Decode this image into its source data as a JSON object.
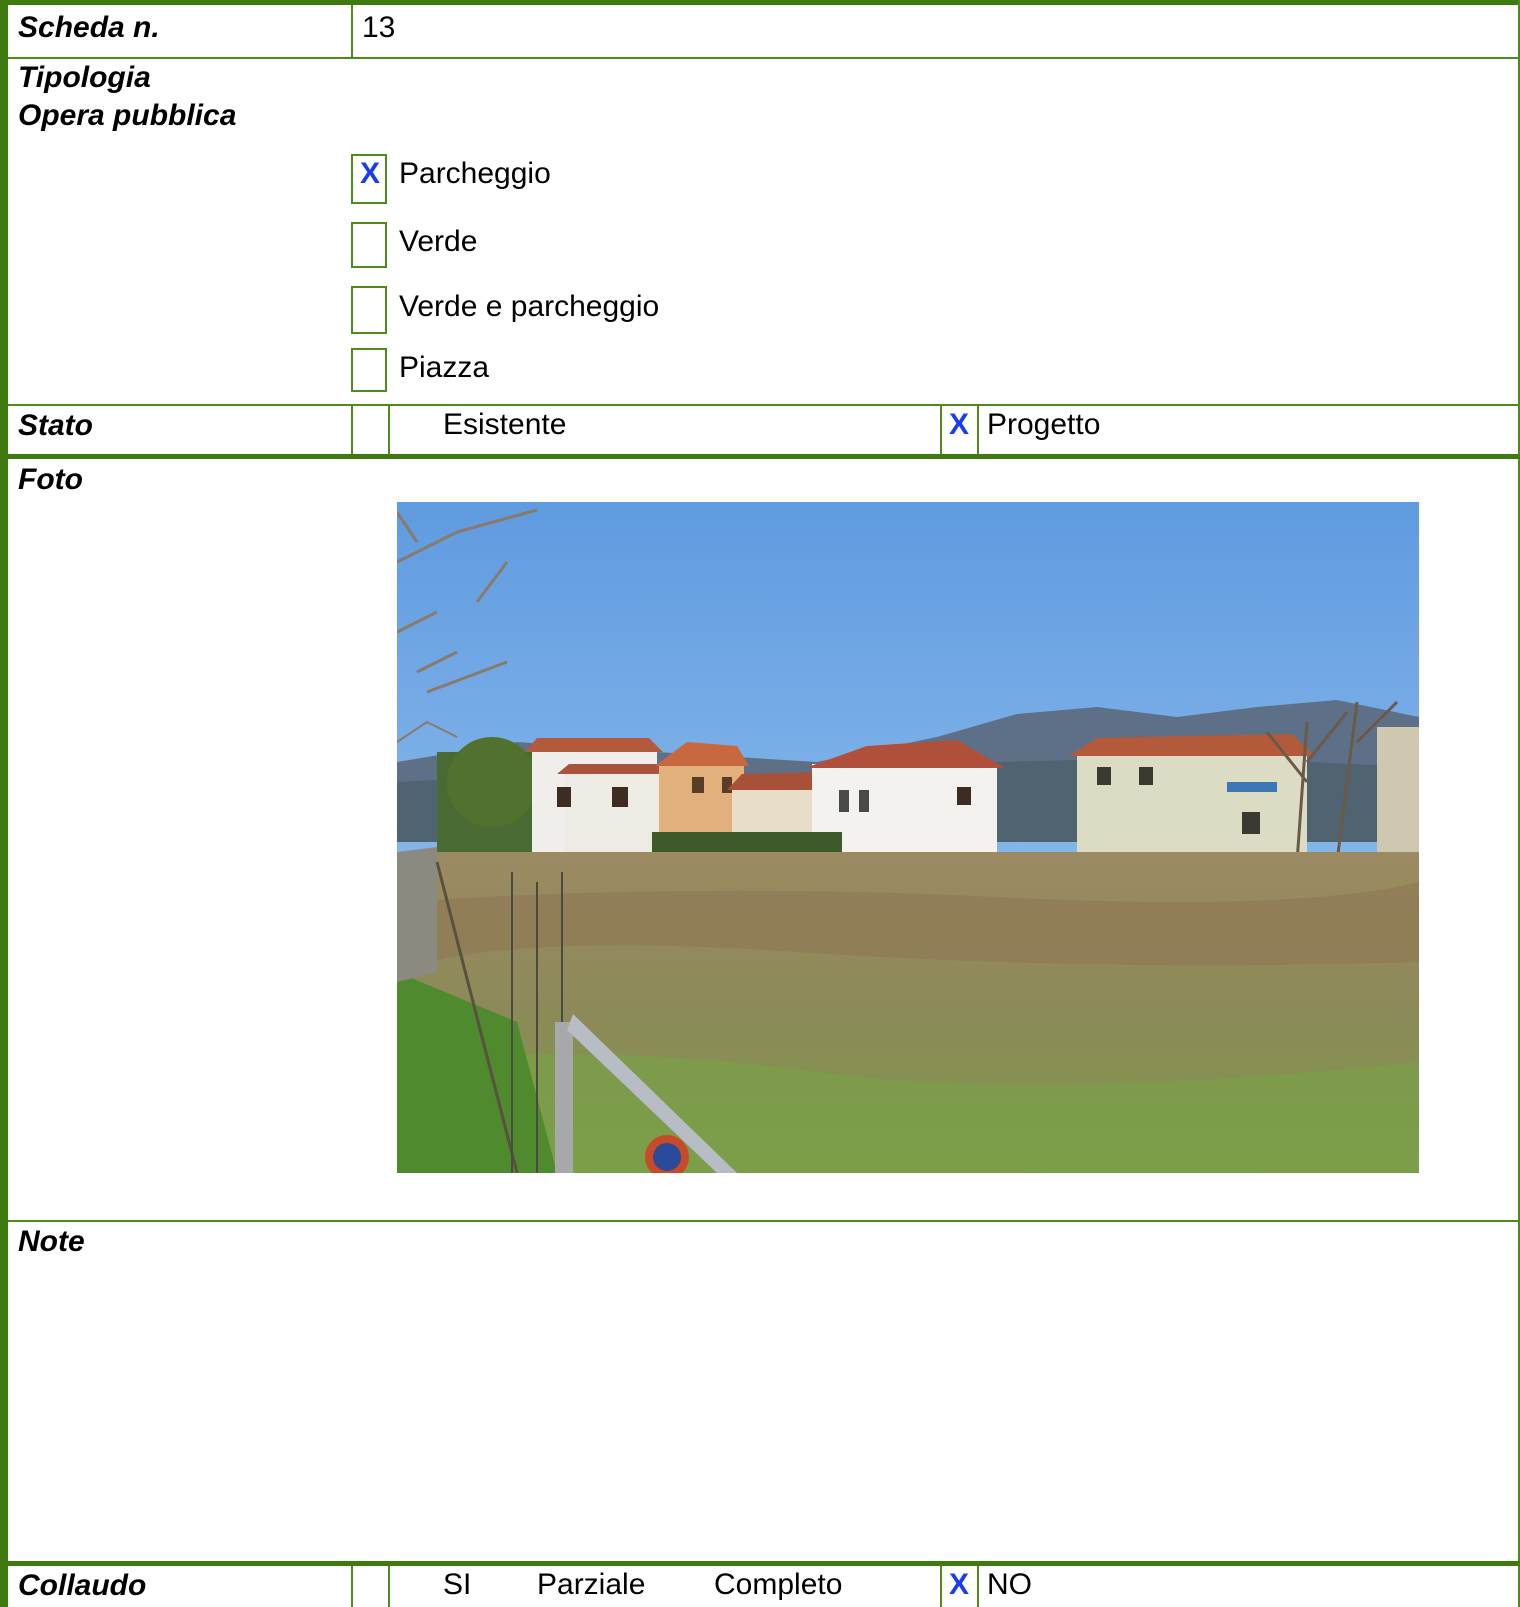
{
  "scheda": {
    "label": "Scheda n.",
    "value": "13"
  },
  "tipologia": {
    "label_line1": "Tipologia",
    "label_line2": "Opera pubblica",
    "options": [
      {
        "label": "Parcheggio",
        "checked": true,
        "mark": "X"
      },
      {
        "label": "Verde",
        "checked": false,
        "mark": ""
      },
      {
        "label": "Verde e parcheggio",
        "checked": false,
        "mark": ""
      },
      {
        "label": "Piazza",
        "checked": false,
        "mark": ""
      }
    ]
  },
  "stato": {
    "label": "Stato",
    "esistente": "Esistente",
    "progetto": "Progetto",
    "progetto_mark": "X"
  },
  "foto": {
    "label": "Foto"
  },
  "note": {
    "label": "Note"
  },
  "collaudo": {
    "label": "Collaudo",
    "si": "SI",
    "parziale": "Parziale",
    "completo": "Completo",
    "no": "NO",
    "no_mark": "X"
  },
  "colors": {
    "border": "#4f8a1c",
    "mark": "#1a3cf0"
  }
}
